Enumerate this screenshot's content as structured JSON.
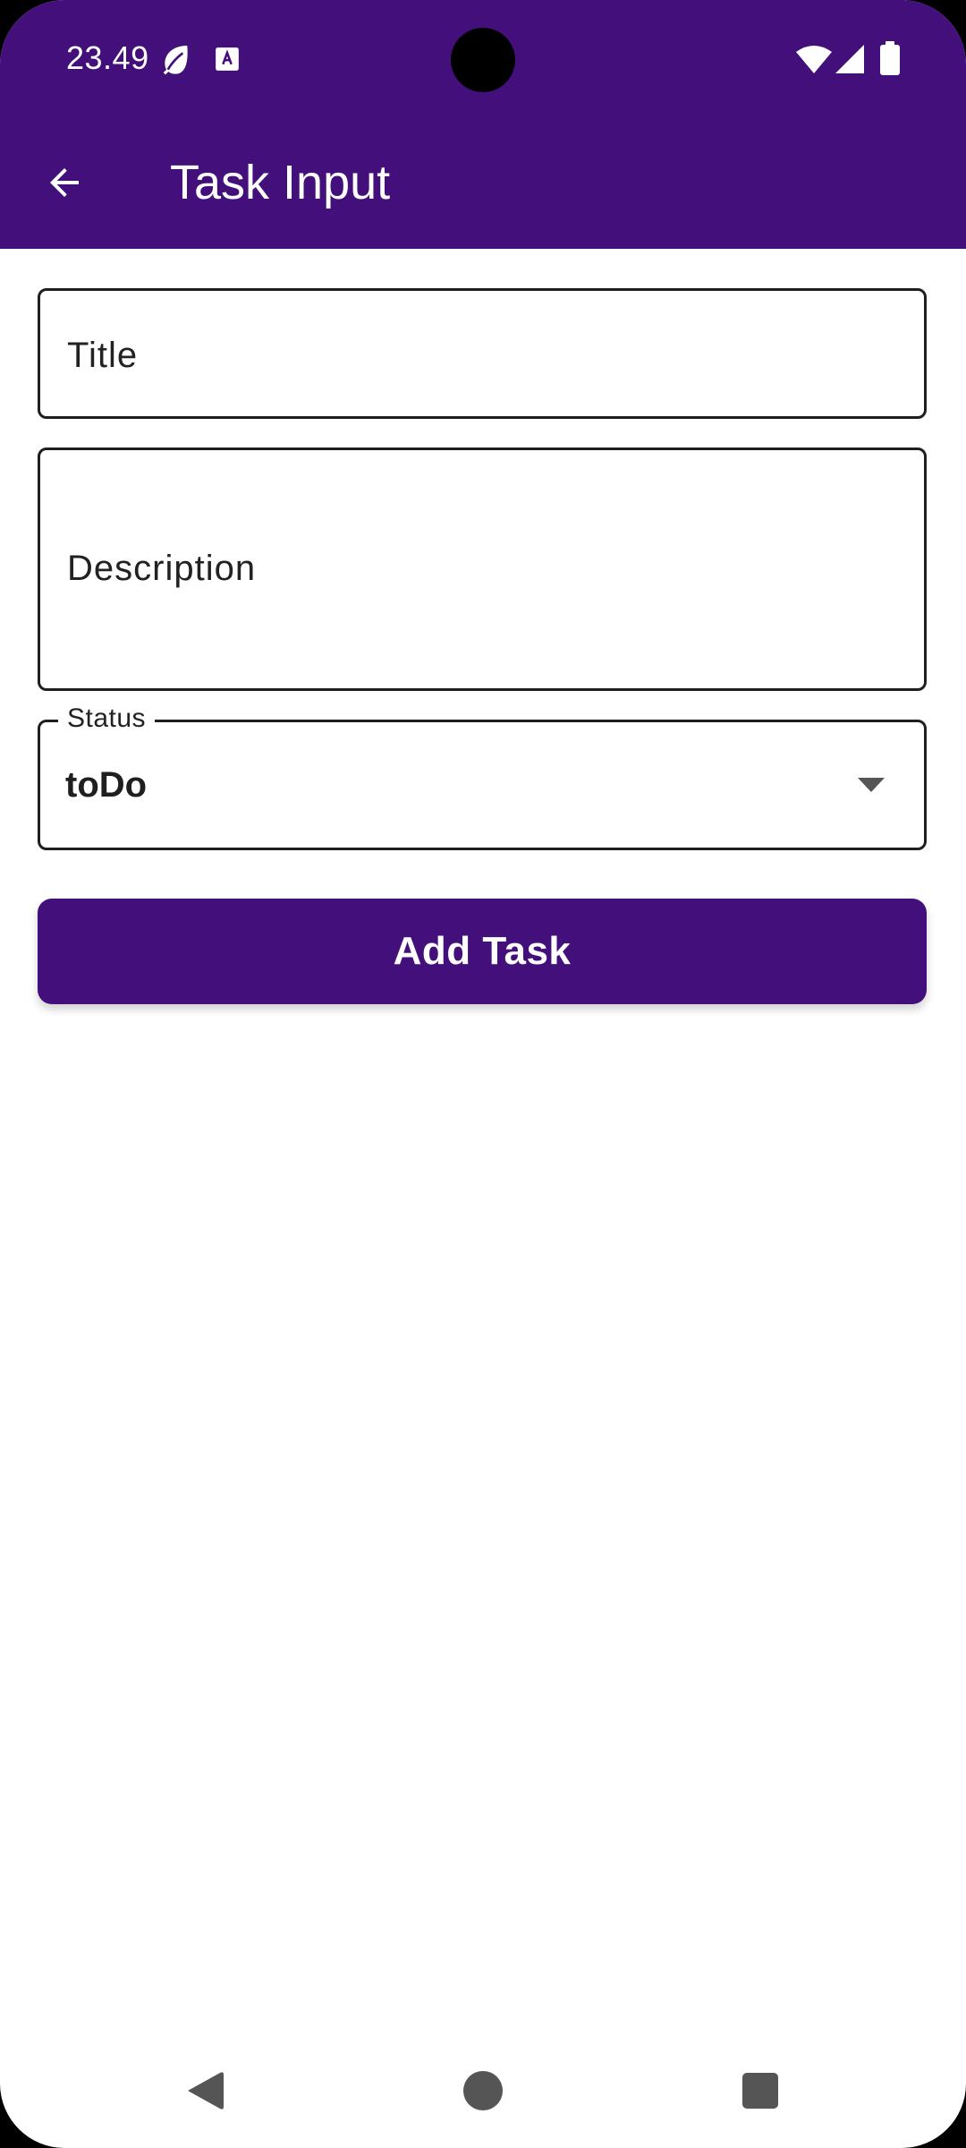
{
  "status_bar": {
    "time": "23.49",
    "icons": [
      "leaf-icon",
      "keyboard-icon",
      "wifi-icon",
      "signal-icon",
      "battery-icon"
    ]
  },
  "app_bar": {
    "title": "Task Input",
    "back_icon": "arrow-back-icon",
    "background": "#430f7a"
  },
  "form": {
    "title_placeholder": "Title",
    "description_placeholder": "Description",
    "status_label": "Status",
    "status_value": "toDo",
    "submit_label": "Add Task"
  },
  "nav_bar": {
    "icons": [
      "nav-back-icon",
      "nav-home-icon",
      "nav-recents-icon"
    ]
  },
  "colors": {
    "primary": "#430f7a",
    "surface": "#ffffff",
    "outline": "#1f1f1f"
  }
}
